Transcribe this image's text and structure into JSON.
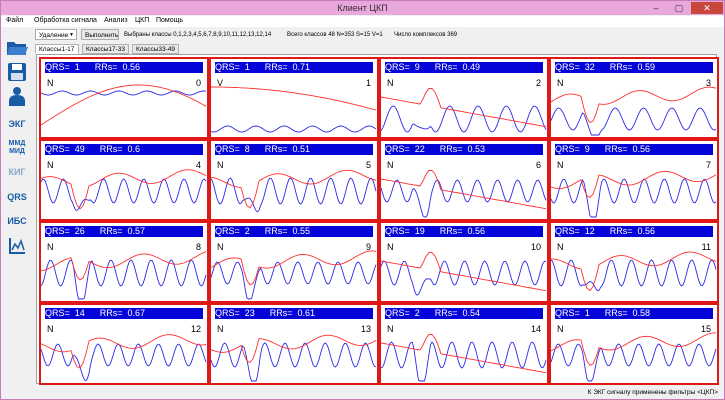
{
  "window": {
    "title": "Клиент ЦКП",
    "min": "–",
    "max": "▢",
    "close": "✕"
  },
  "menu": [
    "Файл",
    "Обработка сигнала",
    "Анализ",
    "ЦКП",
    "Помощь"
  ],
  "toolbar": {
    "mode_select": "Удаление",
    "execute_label": "Выполнить",
    "selected_classes": "Выбраны классы  0,1,2,3,4,5,6,7,8,9,10,11,12,13,12,14",
    "total_classes": "Всего классов  48  N=353 S=15 V=1",
    "complex_count": "Число комплексов  369"
  },
  "sidebar": {
    "ekg": "ЭКГ",
    "mmd": "ММД МИД",
    "kig": "КИГ",
    "qrs": "QRS",
    "ibs": "ИБС"
  },
  "tabs": [
    "Классы1-17",
    "Классы17-33",
    "Классы33-49"
  ],
  "panels": [
    {
      "qrs": "1",
      "rrs": "0.56",
      "label": "N",
      "num": "0"
    },
    {
      "qrs": "1",
      "rrs": "0.71",
      "label": "V",
      "num": "1"
    },
    {
      "qrs": "9",
      "rrs": "0.49",
      "label": "N",
      "num": "2"
    },
    {
      "qrs": "32",
      "rrs": "0.59",
      "label": "N",
      "num": "3"
    },
    {
      "qrs": "49",
      "rrs": "0.6",
      "label": "N",
      "num": "4"
    },
    {
      "qrs": "8",
      "rrs": "0.51",
      "label": "N",
      "num": "5"
    },
    {
      "qrs": "22",
      "rrs": "0.53",
      "label": "N",
      "num": "6"
    },
    {
      "qrs": "9",
      "rrs": "0.56",
      "label": "N",
      "num": "7"
    },
    {
      "qrs": "26",
      "rrs": "0.57",
      "label": "N",
      "num": "8"
    },
    {
      "qrs": "2",
      "rrs": "0.55",
      "label": "N",
      "num": "9"
    },
    {
      "qrs": "19",
      "rrs": "0.56",
      "label": "N",
      "num": "10"
    },
    {
      "qrs": "12",
      "rrs": "0.56",
      "label": "N",
      "num": "11"
    },
    {
      "qrs": "14",
      "rrs": "0.67",
      "label": "N",
      "num": "12"
    },
    {
      "qrs": "23",
      "rrs": "0.61",
      "label": "N",
      "num": "13"
    },
    {
      "qrs": "2",
      "rrs": "0.54",
      "label": "N",
      "num": "14"
    },
    {
      "qrs": "1",
      "rrs": "0.58",
      "label": "N",
      "num": "15"
    }
  ],
  "status": "К ЭКГ сигналу применены фильтры  <ЦКП>",
  "colors": {
    "header": "#0404d8",
    "border": "#e01818",
    "red_trace": "#ff3030",
    "blue_trace": "#2a2ae8"
  }
}
